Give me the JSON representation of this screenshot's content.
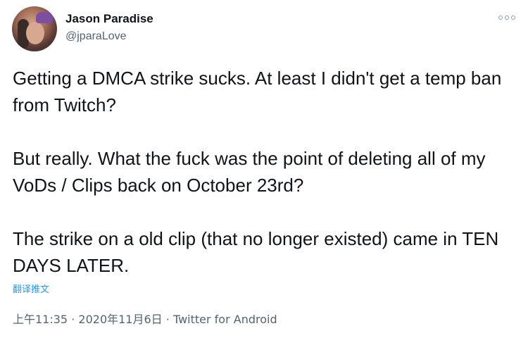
{
  "user": {
    "display_name": "Jason Paradise",
    "handle": "@jparaLove"
  },
  "icons": {
    "more": "more-horizontal-icon"
  },
  "tweet": {
    "paragraphs": [
      "Getting a DMCA strike sucks. At least I didn't get a temp ban from Twitch?",
      "But really. What the fuck was the point of deleting all of my VoDs / Clips back on October 23rd?",
      "The strike on a old clip (that no longer existed) came in TEN DAYS LATER."
    ],
    "translate_label": "翻译推文"
  },
  "meta": {
    "time": "上午11:35",
    "separator": "·",
    "date": "2020年11月6日",
    "source": "Twitter for Android"
  },
  "colors": {
    "text": "#0f1419",
    "secondary": "#536471",
    "link": "#1d9bf0"
  }
}
